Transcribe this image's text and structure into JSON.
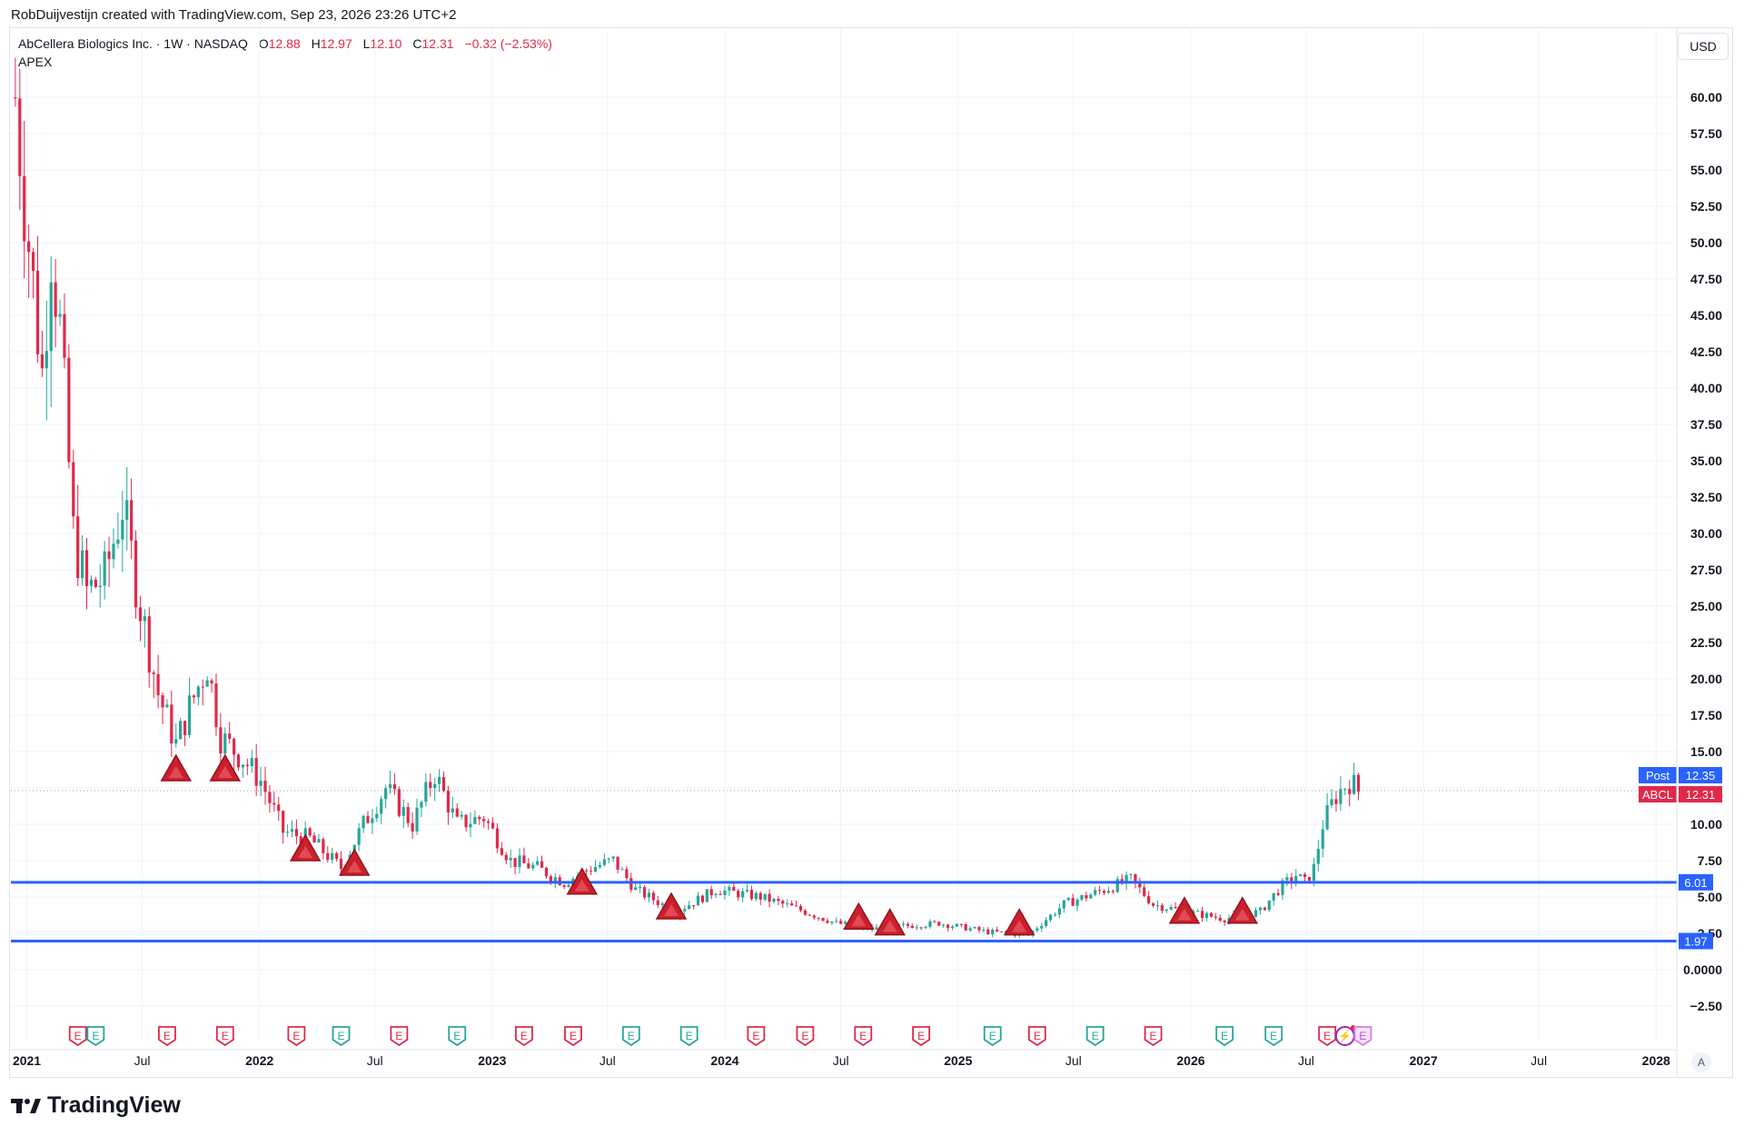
{
  "header": {
    "created_text": "RobDuijvestijn created with TradingView.com, Sep 23, 2026 23:26 UTC+2"
  },
  "legend": {
    "symbol": "AbCellera Biologics Inc. · 1W · NASDAQ",
    "open_label": "O",
    "open": "12.88",
    "high_label": "H",
    "high": "12.97",
    "low_label": "L",
    "low": "12.10",
    "close_label": "C",
    "close": "12.31",
    "change": "−0.32 (−2.53%)",
    "indicator": "APEX"
  },
  "currency": "USD",
  "auto_label": "A",
  "brand": "TradingView",
  "colors": {
    "up": "#26a69a",
    "down": "#e0294a",
    "level_line": "#2962ff",
    "triangle": "#cc1f2c",
    "post_badge": "#2962ff",
    "last_badge": "#e0294a"
  },
  "chart_data": {
    "type": "candlestick",
    "interval": "1W",
    "y_axis": {
      "scale": "linear",
      "range": [
        -4,
        65
      ],
      "ticks": [
        -2.5,
        0,
        2.5,
        5,
        7.5,
        10,
        12.5,
        15,
        17.5,
        20,
        22.5,
        25,
        27.5,
        30,
        32.5,
        35,
        37.5,
        40,
        42.5,
        45,
        47.5,
        50,
        52.5,
        55,
        57.5,
        60
      ],
      "tick_labels": [
        "−2.50",
        "0.0000",
        "2.50",
        "5.00",
        "7.50",
        "10.00",
        "",
        "15.00",
        "17.50",
        "20.00",
        "22.50",
        "25.00",
        "27.50",
        "30.00",
        "32.50",
        "35.00",
        "37.50",
        "40.00",
        "42.50",
        "45.00",
        "47.50",
        "50.00",
        "52.50",
        "55.00",
        "57.50",
        "60.00"
      ]
    },
    "x_axis": {
      "range": [
        "2020-12-07",
        "2028-02-01"
      ],
      "ticks": [
        {
          "date": "2021-01-01",
          "label": "2021",
          "bold": true
        },
        {
          "date": "2021-07-01",
          "label": "Jul",
          "bold": false
        },
        {
          "date": "2022-01-01",
          "label": "2022",
          "bold": true
        },
        {
          "date": "2022-07-01",
          "label": "Jul",
          "bold": false
        },
        {
          "date": "2023-01-01",
          "label": "2023",
          "bold": true
        },
        {
          "date": "2023-07-01",
          "label": "Jul",
          "bold": false
        },
        {
          "date": "2024-01-01",
          "label": "2024",
          "bold": true
        },
        {
          "date": "2024-07-01",
          "label": "Jul",
          "bold": false
        },
        {
          "date": "2025-01-01",
          "label": "2025",
          "bold": true
        },
        {
          "date": "2025-07-01",
          "label": "Jul",
          "bold": false
        },
        {
          "date": "2026-01-01",
          "label": "2026",
          "bold": true
        },
        {
          "date": "2026-07-01",
          "label": "Jul",
          "bold": false
        },
        {
          "date": "2027-01-01",
          "label": "2027",
          "bold": true
        },
        {
          "date": "2027-07-01",
          "label": "Jul",
          "bold": false
        },
        {
          "date": "2028-01-01",
          "label": "2028",
          "bold": true
        }
      ]
    },
    "grid": true,
    "price_path": [
      {
        "date": "2020-12-14",
        "price": 60.0
      },
      {
        "date": "2021-01-04",
        "price": 50.0
      },
      {
        "date": "2021-01-25",
        "price": 41.0
      },
      {
        "date": "2021-02-08",
        "price": 50.0
      },
      {
        "date": "2021-02-22",
        "price": 44.0
      },
      {
        "date": "2021-03-15",
        "price": 30.0
      },
      {
        "date": "2021-04-05",
        "price": 26.0
      },
      {
        "date": "2021-05-03",
        "price": 27.0
      },
      {
        "date": "2021-05-31",
        "price": 32.0
      },
      {
        "date": "2021-06-28",
        "price": 25.0
      },
      {
        "date": "2021-07-26",
        "price": 19.0
      },
      {
        "date": "2021-08-23",
        "price": 15.5
      },
      {
        "date": "2021-09-13",
        "price": 18.0
      },
      {
        "date": "2021-10-11",
        "price": 21.0
      },
      {
        "date": "2021-11-01",
        "price": 16.0
      },
      {
        "date": "2021-12-06",
        "price": 14.5
      },
      {
        "date": "2022-01-03",
        "price": 13.0
      },
      {
        "date": "2022-02-07",
        "price": 9.5
      },
      {
        "date": "2022-03-21",
        "price": 9.0
      },
      {
        "date": "2022-05-09",
        "price": 7.0
      },
      {
        "date": "2022-06-13",
        "price": 10.0
      },
      {
        "date": "2022-07-18",
        "price": 12.5
      },
      {
        "date": "2022-08-29",
        "price": 10.0
      },
      {
        "date": "2022-10-03",
        "price": 13.5
      },
      {
        "date": "2022-11-07",
        "price": 10.0
      },
      {
        "date": "2022-12-19",
        "price": 10.5
      },
      {
        "date": "2023-01-30",
        "price": 7.5
      },
      {
        "date": "2023-03-13",
        "price": 7.0
      },
      {
        "date": "2023-04-24",
        "price": 6.0
      },
      {
        "date": "2023-06-05",
        "price": 7.0
      },
      {
        "date": "2023-07-10",
        "price": 7.5
      },
      {
        "date": "2023-08-14",
        "price": 5.5
      },
      {
        "date": "2023-10-16",
        "price": 4.0
      },
      {
        "date": "2023-12-18",
        "price": 5.5
      },
      {
        "date": "2024-02-26",
        "price": 5.0
      },
      {
        "date": "2024-04-22",
        "price": 4.2
      },
      {
        "date": "2024-06-24",
        "price": 3.2
      },
      {
        "date": "2024-08-19",
        "price": 2.8
      },
      {
        "date": "2024-10-07",
        "price": 3.0
      },
      {
        "date": "2024-12-02",
        "price": 3.2
      },
      {
        "date": "2025-02-17",
        "price": 2.6
      },
      {
        "date": "2025-04-21",
        "price": 2.4
      },
      {
        "date": "2025-06-16",
        "price": 4.5
      },
      {
        "date": "2025-08-18",
        "price": 5.5
      },
      {
        "date": "2025-09-29",
        "price": 6.2
      },
      {
        "date": "2025-11-03",
        "price": 4.5
      },
      {
        "date": "2025-12-22",
        "price": 4.0
      },
      {
        "date": "2026-02-23",
        "price": 3.5
      },
      {
        "date": "2026-04-20",
        "price": 4.0
      },
      {
        "date": "2026-05-18",
        "price": 5.5
      },
      {
        "date": "2026-06-15",
        "price": 6.5
      },
      {
        "date": "2026-06-29",
        "price": 6.0
      },
      {
        "date": "2026-07-13",
        "price": 7.0
      },
      {
        "date": "2026-07-27",
        "price": 10.0
      },
      {
        "date": "2026-08-17",
        "price": 12.0
      },
      {
        "date": "2026-09-07",
        "price": 13.0
      },
      {
        "date": "2026-09-21",
        "price": 12.31
      }
    ],
    "horizontal_levels": [
      {
        "price": 6.01,
        "label": "6.01"
      },
      {
        "price": 1.97,
        "label": "1.97"
      }
    ],
    "price_badges": [
      {
        "name": "Post",
        "value": "12.35",
        "price": 12.35
      },
      {
        "name": "ABCL",
        "value": "12.31",
        "price": 12.31
      }
    ],
    "current_price_line": 12.31,
    "signal_triangles": [
      {
        "date": "2021-08-23",
        "price": 13.0
      },
      {
        "date": "2021-11-08",
        "price": 13.0
      },
      {
        "date": "2022-03-14",
        "price": 7.5
      },
      {
        "date": "2022-05-30",
        "price": 6.5
      },
      {
        "date": "2023-05-22",
        "price": 5.2
      },
      {
        "date": "2023-10-09",
        "price": 3.5
      },
      {
        "date": "2024-07-29",
        "price": 2.8
      },
      {
        "date": "2024-09-16",
        "price": 2.4
      },
      {
        "date": "2025-04-07",
        "price": 2.4
      },
      {
        "date": "2025-12-22",
        "price": 3.2
      },
      {
        "date": "2026-03-23",
        "price": 3.2
      }
    ],
    "events": [
      {
        "date": "2021-03-22",
        "type": "earnings",
        "label": "E"
      },
      {
        "date": "2021-04-19",
        "type": "dividend",
        "label": "E"
      },
      {
        "date": "2021-08-09",
        "type": "earnings",
        "label": "E"
      },
      {
        "date": "2021-11-08",
        "type": "earnings",
        "label": "E"
      },
      {
        "date": "2022-02-28",
        "type": "earnings",
        "label": "E"
      },
      {
        "date": "2022-05-09",
        "type": "dividend",
        "label": "E"
      },
      {
        "date": "2022-08-08",
        "type": "earnings",
        "label": "E"
      },
      {
        "date": "2022-11-07",
        "type": "dividend",
        "label": "E"
      },
      {
        "date": "2023-02-20",
        "type": "earnings",
        "label": "E"
      },
      {
        "date": "2023-05-08",
        "type": "earnings",
        "label": "E"
      },
      {
        "date": "2023-08-07",
        "type": "dividend",
        "label": "E"
      },
      {
        "date": "2023-11-06",
        "type": "dividend",
        "label": "E"
      },
      {
        "date": "2024-02-19",
        "type": "earnings",
        "label": "E"
      },
      {
        "date": "2024-05-06",
        "type": "earnings",
        "label": "E"
      },
      {
        "date": "2024-08-05",
        "type": "earnings",
        "label": "E"
      },
      {
        "date": "2024-11-04",
        "type": "earnings",
        "label": "E"
      },
      {
        "date": "2025-02-24",
        "type": "dividend",
        "label": "E"
      },
      {
        "date": "2025-05-05",
        "type": "earnings",
        "label": "E"
      },
      {
        "date": "2025-08-04",
        "type": "dividend",
        "label": "E"
      },
      {
        "date": "2025-11-03",
        "type": "earnings",
        "label": "E"
      },
      {
        "date": "2026-02-23",
        "type": "dividend",
        "label": "E"
      },
      {
        "date": "2026-05-11",
        "type": "dividend",
        "label": "E"
      },
      {
        "date": "2026-08-03",
        "type": "earnings",
        "label": "E"
      },
      {
        "date": "2026-08-31",
        "type": "split",
        "label": "⚡"
      },
      {
        "date": "2026-09-28",
        "type": "upcoming",
        "label": "E"
      }
    ]
  }
}
